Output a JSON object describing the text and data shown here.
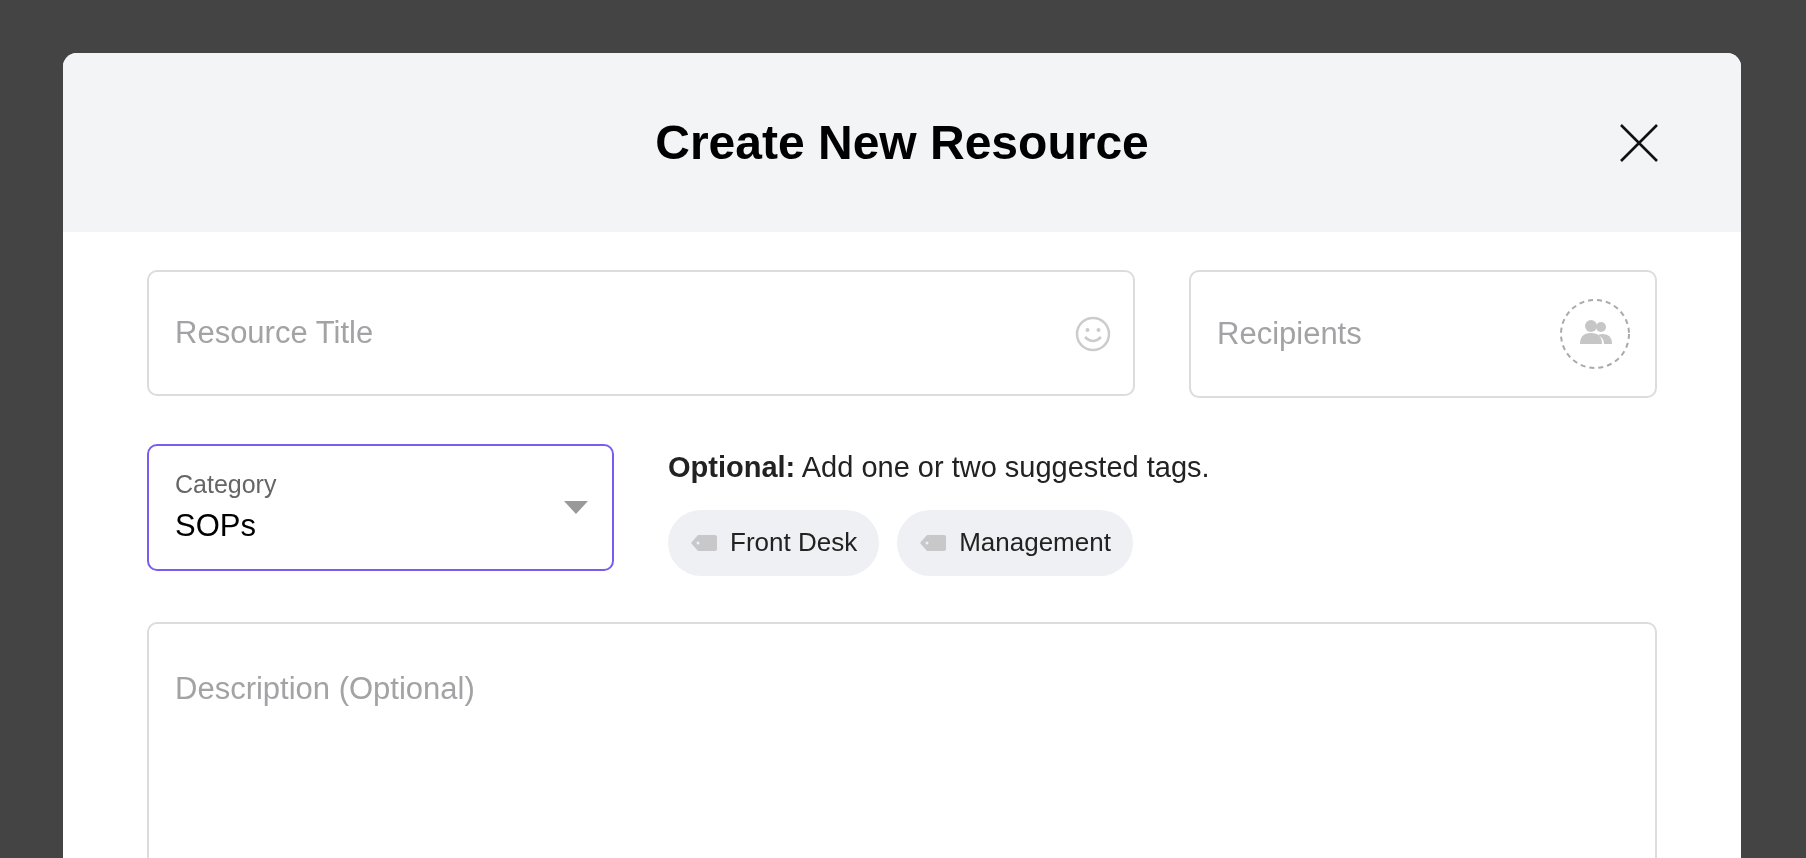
{
  "dialog": {
    "title": "Create New Resource"
  },
  "resource_title": {
    "placeholder": "Resource Title"
  },
  "recipients": {
    "placeholder": "Recipients"
  },
  "category": {
    "label": "Category",
    "value": "SOPs",
    "focused": true
  },
  "tags_hint": "**Optional:** Add one or two suggested tags.",
  "suggested_tags": [
    {
      "label": "Front Desk"
    },
    {
      "label": "Management"
    }
  ],
  "description": {
    "placeholder": "Description (Optional)"
  }
}
